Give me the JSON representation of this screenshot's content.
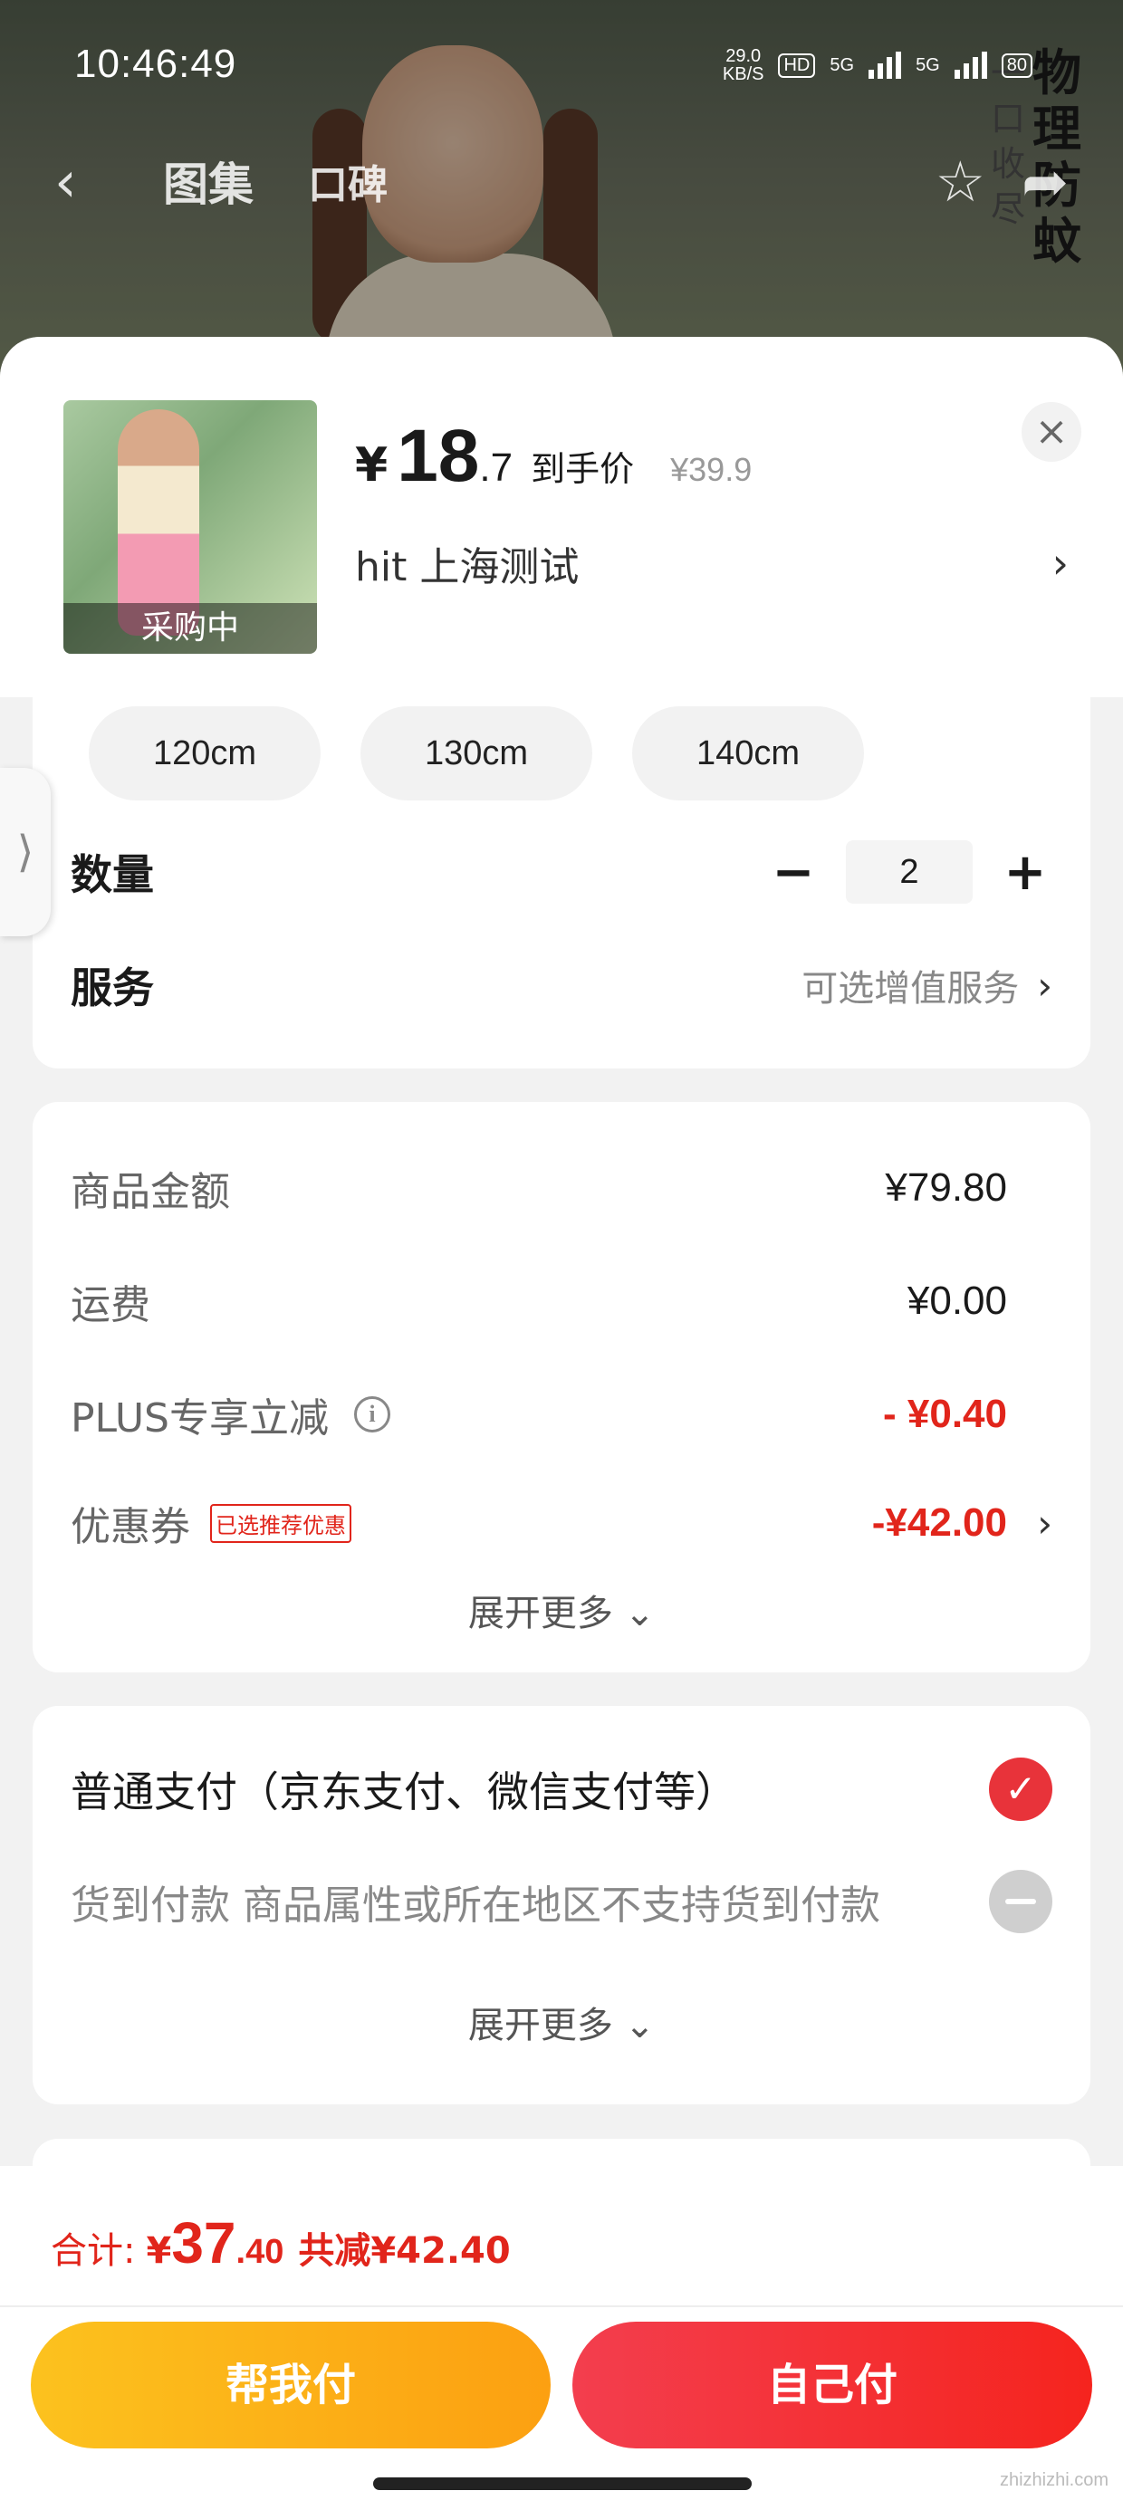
{
  "status_bar": {
    "time": "10:46:49",
    "net_speed": "29.0",
    "net_unit": "KB/S",
    "hd_chip": "HD",
    "sig1": "5G",
    "sig2": "5G",
    "battery": "80"
  },
  "background": {
    "nav_tab1": "图集",
    "nav_tab2": "口碑",
    "promo_text": "物理防蚊",
    "promo_text2": "一口收尽"
  },
  "sheet": {
    "thumb_tag": "采购中",
    "currency": "¥",
    "price_int": "18",
    "price_dec": ".7",
    "price_tag": "到手价",
    "orig_price": "¥39.9",
    "close_symbol": "×",
    "address": "hit  上海测试",
    "address_arrow": "›"
  },
  "sizes": [
    "120cm",
    "130cm",
    "140cm"
  ],
  "quantity": {
    "label": "数量",
    "minus": "−",
    "value": "2",
    "plus": "+"
  },
  "service": {
    "label": "服务",
    "value": "可选增值服务",
    "arrow": "›"
  },
  "side_tab": "⟩",
  "amounts": {
    "items": [
      {
        "label": "商品金额",
        "value": "¥79.80"
      },
      {
        "label": "运费",
        "value": "¥0.00"
      },
      {
        "label": "PLUS专享立减",
        "value": "- ¥0.40"
      },
      {
        "label": "优惠券",
        "badge": "已选推荐优惠",
        "value": "-¥42.00"
      }
    ],
    "info_symbol": "i",
    "more": "展开更多 ⌄"
  },
  "payment": {
    "normal": "普通支付（京东支付、微信支付等）",
    "cod": "货到付款 商品属性或所在地区不支持货到付款",
    "check_symbol": "✓",
    "more": "展开更多 ⌄"
  },
  "footer": {
    "total_label": "合计:",
    "currency": "¥",
    "total_int": "37",
    "total_dec": ".40",
    "saved": "共减¥42.40",
    "btn_help": "帮我付",
    "btn_self": "自己付"
  },
  "watermark": "zhizhizhi.com",
  "colors": {
    "accent_red": "#e1251b",
    "btn_yellow": "#fcb418",
    "btn_red": "#f3302f"
  }
}
